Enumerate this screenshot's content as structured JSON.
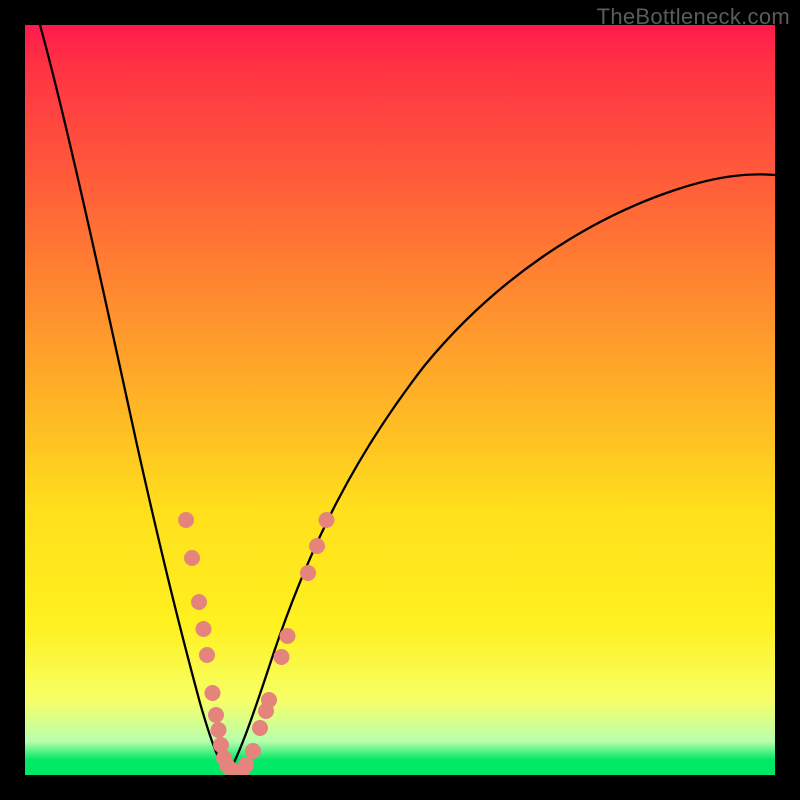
{
  "watermark_text": "TheBottleneck.com",
  "colors": {
    "frame": "#000000",
    "bead": "#e4847d",
    "curve": "#000000",
    "gradient_top": "#ff1a4d",
    "gradient_bottom": "#00e865"
  },
  "chart_data": {
    "type": "line",
    "title": "",
    "xlabel": "",
    "ylabel": "",
    "xlim": [
      0,
      100
    ],
    "ylim": [
      0,
      100
    ],
    "note": "no axis ticks or labels visible; x and y values are positional percentages derived from the image",
    "series": [
      {
        "name": "left-curve",
        "x": [
          2,
          5,
          10,
          15,
          18,
          21,
          23,
          24.6,
          25.5,
          26.2,
          27
        ],
        "y": [
          100,
          88,
          67,
          44,
          29,
          15,
          7,
          3,
          1.5,
          0.8,
          0
        ]
      },
      {
        "name": "right-curve",
        "x": [
          27,
          28,
          29.5,
          31,
          33,
          36,
          42,
          50,
          60,
          72,
          86,
          100
        ],
        "y": [
          0,
          1,
          3,
          6,
          10,
          16,
          28,
          41,
          53,
          64,
          73,
          80
        ]
      }
    ],
    "markers": [
      {
        "series": "left-curve",
        "points": [
          {
            "x": 21.5,
            "y": 34
          },
          {
            "x": 22.3,
            "y": 29
          },
          {
            "x": 23.2,
            "y": 23
          },
          {
            "x": 23.8,
            "y": 19.5
          },
          {
            "x": 24.3,
            "y": 16
          },
          {
            "x": 25.0,
            "y": 11
          },
          {
            "x": 25.5,
            "y": 8
          },
          {
            "x": 25.8,
            "y": 6
          },
          {
            "x": 26.2,
            "y": 4
          },
          {
            "x": 26.5,
            "y": 2.3
          },
          {
            "x": 27.0,
            "y": 1.2
          },
          {
            "x": 27.6,
            "y": 0.6
          },
          {
            "x": 28.2,
            "y": 0.4
          }
        ]
      },
      {
        "series": "right-curve",
        "points": [
          {
            "x": 28.9,
            "y": 0.6
          },
          {
            "x": 29.5,
            "y": 1.3
          },
          {
            "x": 30.4,
            "y": 3.2
          },
          {
            "x": 31.4,
            "y": 6.2
          },
          {
            "x": 32.1,
            "y": 8.5
          },
          {
            "x": 32.5,
            "y": 10
          },
          {
            "x": 34.2,
            "y": 15.8
          },
          {
            "x": 35.0,
            "y": 18.5
          },
          {
            "x": 37.7,
            "y": 27
          },
          {
            "x": 38.9,
            "y": 30.5
          },
          {
            "x": 40.2,
            "y": 34
          }
        ]
      }
    ]
  }
}
